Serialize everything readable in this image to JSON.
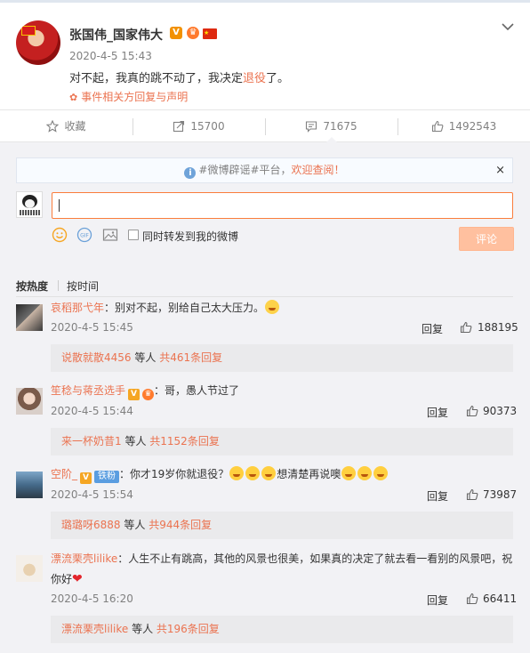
{
  "post": {
    "author": "张国伟_国家伟大",
    "time": "2020-4-5 15:43",
    "text_before": "对不起，我真的跳不动了，我决定",
    "text_highlight": "退役",
    "text_after": "了。",
    "event_link": "事件相关方回复与声明"
  },
  "actions": {
    "favorite": "收藏",
    "repost": "15700",
    "comment": "71675",
    "like": "1492543"
  },
  "rumor_bar": {
    "prefix": "#微博辟谣#平台，",
    "link": "欢迎查阅！",
    "close": "×"
  },
  "composer": {
    "placeholder": "",
    "repost_label": "同时转发到我的微博",
    "submit": "评论"
  },
  "sort": {
    "hot": "按热度",
    "time": "按时间"
  },
  "comments": [
    {
      "name": "哀稻那弋年",
      "text": "：别对不起，别给自己太大压力。",
      "time": "2020-4-5 15:45",
      "reply": "回复",
      "likes": "188195",
      "sub_name": "说散就散4456",
      "sub_mid": " 等人 ",
      "sub_count": "共461条回复"
    },
    {
      "name": "笙稔与蒋丞选手",
      "text": "：哥，愚人节过了",
      "time": "2020-4-5 15:44",
      "reply": "回复",
      "likes": "90373",
      "sub_name": "来一杯奶昔1",
      "sub_mid": " 等人 ",
      "sub_count": "共1152条回复"
    },
    {
      "name": "空阶_",
      "tag": "铁粉",
      "text_a": "：你才19岁你就退役？",
      "text_b": "想清楚再说噢",
      "time": "2020-4-5 15:54",
      "reply": "回复",
      "likes": "73987",
      "sub_name": "璐璐呀6888",
      "sub_mid": " 等人 ",
      "sub_count": "共944条回复"
    },
    {
      "name": "漂流栗壳lilike",
      "text_line1": "：人生不止有跳高，其他的风景也很美，如果真的决定了就去看一看别的风景吧，祝",
      "text_line2": "你好",
      "time": "2020-4-5 16:20",
      "reply": "回复",
      "likes": "66411",
      "sub_name": "漂流栗壳lilike",
      "sub_mid": " 等人 ",
      "sub_count": "共196条回复"
    }
  ],
  "colors": {
    "accent": "#eb7350",
    "submit_bg": "#ffc09f",
    "section_bg": "#f2f2f5"
  }
}
